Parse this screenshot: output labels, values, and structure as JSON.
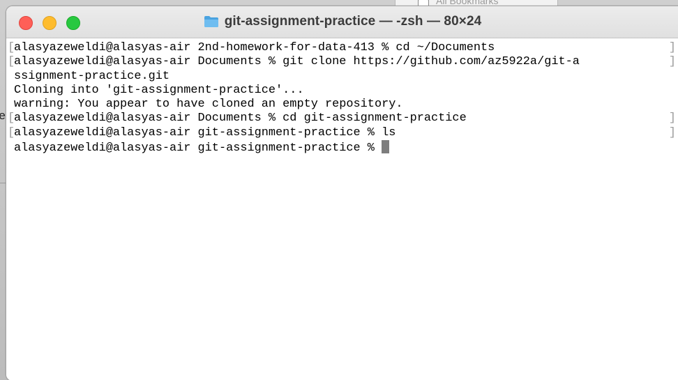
{
  "window": {
    "title": "git-assignment-practice — -zsh — 80×24",
    "folder_icon": "folder-icon",
    "controls": [
      "close",
      "minimize",
      "maximize"
    ]
  },
  "background_window": {
    "label": "All Bookmarks"
  },
  "left_edge_fragment": "e",
  "terminal": {
    "lines": [
      {
        "text": "alasyazeweldi@alasyas-air 2nd-homework-for-data-413 % cd ~/Documents",
        "mark_left": "[",
        "mark_right": "]"
      },
      {
        "text": "alasyazeweldi@alasyas-air Documents % git clone https://github.com/az5922a/git-a",
        "mark_left": "[",
        "mark_right": "]"
      },
      {
        "text": "ssignment-practice.git",
        "mark_left": "",
        "mark_right": ""
      },
      {
        "text": "Cloning into 'git-assignment-practice'...",
        "mark_left": "",
        "mark_right": ""
      },
      {
        "text": "warning: You appear to have cloned an empty repository.",
        "mark_left": "",
        "mark_right": ""
      },
      {
        "text": "alasyazeweldi@alasyas-air Documents % cd git-assignment-practice",
        "mark_left": "[",
        "mark_right": "]"
      },
      {
        "text": "alasyazeweldi@alasyas-air git-assignment-practice % ls",
        "mark_left": "[",
        "mark_right": "]"
      },
      {
        "text": "alasyazeweldi@alasyas-air git-assignment-practice % ",
        "mark_left": "",
        "mark_right": ""
      }
    ]
  }
}
